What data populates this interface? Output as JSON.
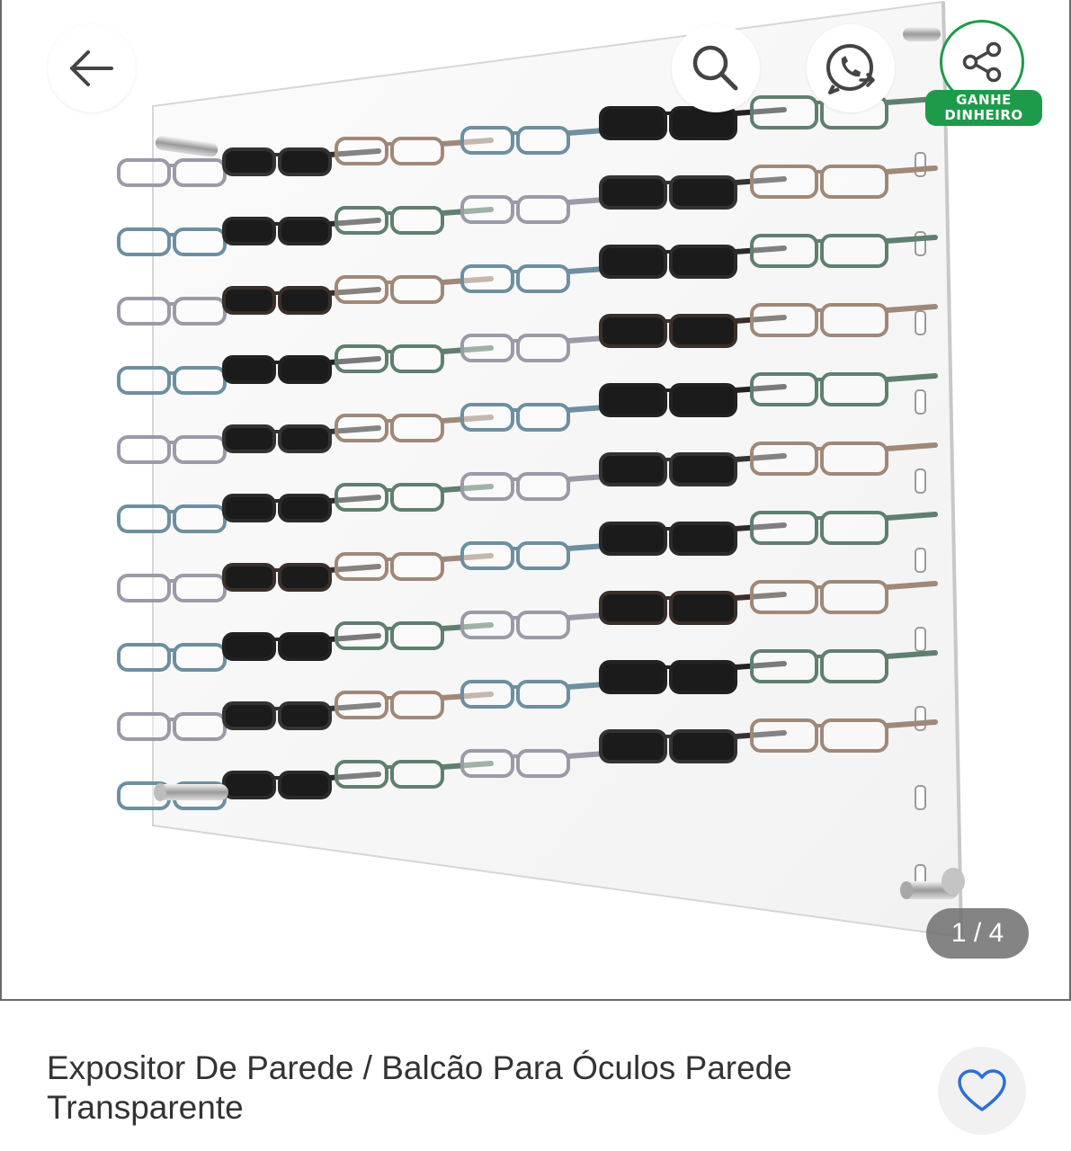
{
  "header": {
    "back_icon": "arrow-left-icon",
    "search_icon": "search-icon",
    "whatsapp_icon": "whatsapp-share-icon",
    "share_icon": "share-icon",
    "earn_badge": {
      "line1": "GANHE",
      "line2": "DINHEIRO"
    }
  },
  "gallery": {
    "counter": "1 / 4",
    "image_subject": "glasses-wall-display"
  },
  "product": {
    "title": "Expositor De Parede / Balcão Para Óculos Parede Transparente",
    "favorite_icon": "heart-outline-icon"
  },
  "colors": {
    "accent_green": "#1e9b4a",
    "favorite_blue": "#2d6fd6",
    "text": "#333333"
  }
}
